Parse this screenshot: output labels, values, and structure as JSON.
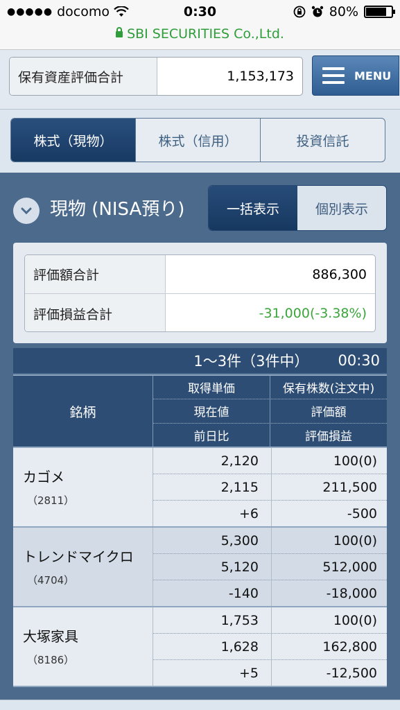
{
  "status_bar": {
    "signal_dots": "●●●●●",
    "carrier": "docomo",
    "time": "0:30",
    "battery": "80%",
    "battery_level": 0.8,
    "url": "SBI SECURITIES Co.,Ltd."
  },
  "header": {
    "total_label": "保有資産評価合計",
    "total_value": "1,153,173",
    "menu_label": "MENU"
  },
  "tabs": [
    {
      "label": "株式（現物）",
      "active": true
    },
    {
      "label": "株式（信用）",
      "active": false
    },
    {
      "label": "投資信託",
      "active": false
    }
  ],
  "section": {
    "title": "現物 (NISA預り)",
    "toggle": [
      "一括表示",
      "個別表示"
    ]
  },
  "summary": {
    "rows": [
      {
        "label": "評価額合計",
        "value": "886,300"
      },
      {
        "label": "評価損益合計",
        "value": "-31,000(-3.38%)"
      }
    ]
  },
  "count": {
    "range": "1〜3件（3件中）",
    "time": "00:30"
  },
  "table": {
    "name_header": "銘柄",
    "col_headers": [
      [
        "取得単価",
        "保有株数(注文中)"
      ],
      [
        "現在値",
        "評価額"
      ],
      [
        "前日比",
        "評価損益"
      ]
    ],
    "rows": [
      {
        "name": "カゴメ",
        "code": "（2811）",
        "v": [
          [
            "2,120",
            "100(0)"
          ],
          [
            "2,115",
            "211,500"
          ],
          [
            "+6",
            "-500"
          ]
        ]
      },
      {
        "name": "トレンドマイクロ",
        "code": "（4704）",
        "v": [
          [
            "5,300",
            "100(0)"
          ],
          [
            "5,120",
            "512,000"
          ],
          [
            "-140",
            "-18,000"
          ]
        ]
      },
      {
        "name": "大塚家具",
        "code": "（8186）",
        "v": [
          [
            "1,753",
            "100(0)"
          ],
          [
            "1,628",
            "162,800"
          ],
          [
            "+5",
            "-12,500"
          ]
        ]
      }
    ]
  },
  "colors": {
    "positive": "#e02020",
    "negative": "#3aa53a",
    "secure": "#2e9d3a",
    "panel": "#4c6b8c"
  }
}
